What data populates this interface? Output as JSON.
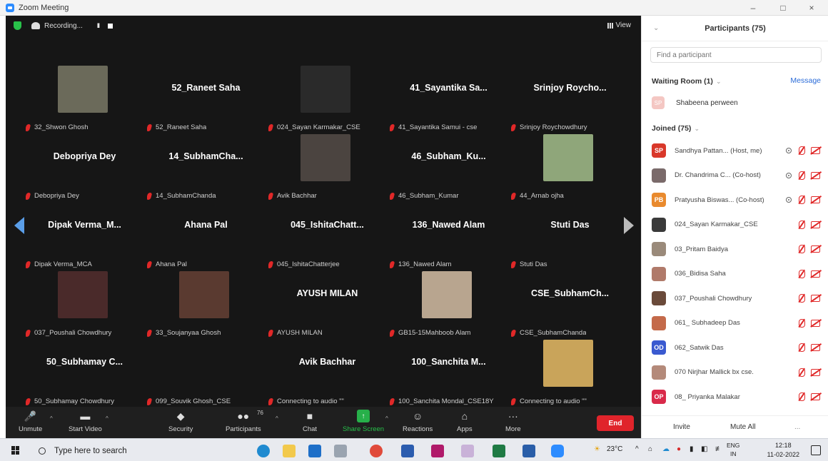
{
  "window": {
    "title": "Zoom Meeting",
    "controls": [
      "–",
      "□",
      "×"
    ]
  },
  "topbar": {
    "recording_label": "Recording...",
    "pause_glyph": "II",
    "view_label": "View"
  },
  "tiles": [
    {
      "big": "",
      "label": "32_Shwon Ghosh",
      "photo": "#6b6a5a"
    },
    {
      "big": "52_Raneet Saha",
      "label": "52_Raneet Saha",
      "photo": ""
    },
    {
      "big": "",
      "label": "024_Sayan Karmakar_CSE",
      "photo": "#2a2a2a"
    },
    {
      "big": "41_Sayantika Sa...",
      "label": "41_Sayantika Samui - cse",
      "photo": ""
    },
    {
      "big": "Srinjoy Roycho...",
      "label": "Srinjoy Roychowdhury",
      "photo": ""
    },
    {
      "big": "Debopriya Dey",
      "label": "Debopriya Dey",
      "photo": ""
    },
    {
      "big": "14_SubhamCha...",
      "label": "14_SubhamChanda",
      "photo": ""
    },
    {
      "big": "",
      "label": "Avik Bachhar",
      "photo": "#4b4440"
    },
    {
      "big": "46_Subham_Ku...",
      "label": "46_Subham_Kumar",
      "photo": ""
    },
    {
      "big": "",
      "label": "44_Arnab ojha",
      "photo": "#8fa67a"
    },
    {
      "big": "Dipak Verma_M...",
      "label": "Dipak Verma_MCA",
      "photo": ""
    },
    {
      "big": "Ahana Pal",
      "label": "Ahana Pal",
      "photo": ""
    },
    {
      "big": "045_IshitaChatt...",
      "label": "045_IshitaChatterjee",
      "photo": ""
    },
    {
      "big": "136_Nawed Alam",
      "label": "136_Nawed Alam",
      "photo": ""
    },
    {
      "big": "Stuti Das",
      "label": "Stuti Das",
      "photo": ""
    },
    {
      "big": "",
      "label": "037_Poushali Chowdhury",
      "photo": "#4a2a2a"
    },
    {
      "big": "",
      "label": "33_Soujanyaa Ghosh",
      "photo": "#5a3a30"
    },
    {
      "big": "AYUSH MILAN",
      "label": "AYUSH MILAN",
      "photo": ""
    },
    {
      "big": "",
      "label": "GB15-15Mahboob Alam",
      "photo": "#b8a58f"
    },
    {
      "big": "CSE_SubhamCh...",
      "label": "CSE_SubhamChanda",
      "photo": ""
    },
    {
      "big": "50_Subhamay C...",
      "label": "50_Subhamay Chowdhury",
      "photo": ""
    },
    {
      "big": "",
      "label": "099_Souvik Ghosh_CSE",
      "photo": ""
    },
    {
      "big": "Avik Bachhar",
      "label": "Connecting to audio \"\"",
      "photo": ""
    },
    {
      "big": "100_Sanchita M...",
      "label": "100_Sanchita Mondal_CSE18Y",
      "photo": ""
    },
    {
      "big": "",
      "label": "Connecting to audio \"\"",
      "photo": "#c9a45a"
    }
  ],
  "toolbar": {
    "unmute": "Unmute",
    "start_video": "Start Video",
    "security": "Security",
    "participants": "Participants",
    "participants_count": "76",
    "chat": "Chat",
    "share_screen": "Share Screen",
    "reactions": "Reactions",
    "apps": "Apps",
    "more": "More",
    "end": "End"
  },
  "panel": {
    "title": "Participants (75)",
    "search_placeholder": "Find a participant",
    "waiting_room": "Waiting Room (1)",
    "message": "Message",
    "waiting_name": "Shabeena perween",
    "waiting_initials": "SP",
    "joined": "Joined (75)",
    "participants": [
      {
        "initials": "SP",
        "name": "Sandhya Pattan... (Host, me)",
        "color": "#d9382a",
        "share": true
      },
      {
        "initials": "",
        "name": "Dr. Chandrima C... (Co-host)",
        "color": "#7a6a6a",
        "share": true
      },
      {
        "initials": "PB",
        "name": "Pratyusha Biswas... (Co-host)",
        "color": "#e98a2e",
        "share": true
      },
      {
        "initials": "",
        "name": "024_Sayan Karmakar_CSE",
        "color": "#3a3a3a",
        "share": false
      },
      {
        "initials": "",
        "name": "03_Pritam Baidya",
        "color": "#9a8a7a",
        "share": false
      },
      {
        "initials": "",
        "name": "036_Bidisa Saha",
        "color": "#b07a6a",
        "share": false
      },
      {
        "initials": "",
        "name": "037_Poushali Chowdhury",
        "color": "#6a4a3a",
        "share": false
      },
      {
        "initials": "",
        "name": "061_ Subhadeep Das",
        "color": "#c46a4a",
        "share": false
      },
      {
        "initials": "OD",
        "name": "062_Satwik Das",
        "color": "#3a5ad0",
        "share": false
      },
      {
        "initials": "",
        "name": "070 Nirjhar Mallick bx cse.",
        "color": "#b48a7a",
        "share": false
      },
      {
        "initials": "OP",
        "name": "08_ Priyanka Malakar",
        "color": "#d92a4a",
        "share": false
      }
    ],
    "invite": "Invite",
    "mute_all": "Mute All",
    "more": "..."
  },
  "taskbar": {
    "search_text": "Type here to search",
    "weather": "23°C",
    "lang": "ENG",
    "region": "IN",
    "time": "12:18",
    "date": "11-02-2022"
  },
  "colors": {
    "meeting_bg": "#161616",
    "accent": "#2d8cff",
    "end": "#e0242b",
    "mute_red": "#e02828"
  }
}
